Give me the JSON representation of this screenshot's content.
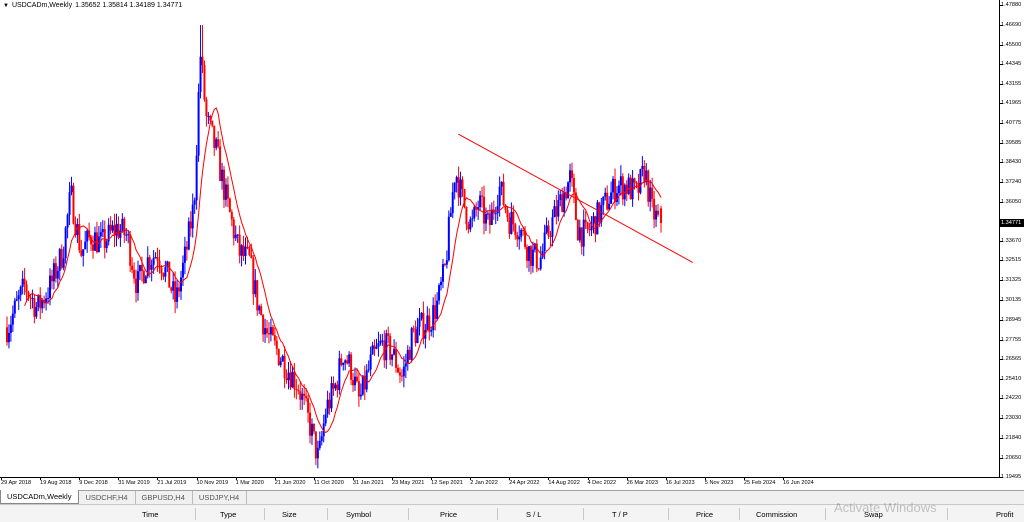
{
  "chart": {
    "title": "USDCADm,Weekly",
    "ohlc": "1.35652 1.35814 1.34189 1.34771",
    "current_price": "1.34771",
    "colors": {
      "bull": "#0000ff",
      "bear": "#ff0000",
      "ma": "#ff0000",
      "trendline": "#ff0000"
    }
  },
  "price_scale": [
    "1.47880",
    "1.46690",
    "1.45500",
    "1.44345",
    "1.43155",
    "1.41965",
    "1.40775",
    "1.39585",
    "1.38430",
    "1.37240",
    "1.36050",
    "1.33670",
    "1.32515",
    "1.31325",
    "1.30135",
    "1.28945",
    "1.27755",
    "1.26565",
    "1.25410",
    "1.24220",
    "1.23030",
    "1.21840",
    "1.20650",
    "1.19495"
  ],
  "time_scale": [
    "29 Apr 2018",
    "19 Aug 2018",
    "9 Dec 2018",
    "31 Mar 2019",
    "21 Jul 2019",
    "10 Nov 2019",
    "1 Mar 2020",
    "21 Jun 2020",
    "11 Oct 2020",
    "31 Jan 2021",
    "23 May 2021",
    "12 Sep 2021",
    "2 Jan 2022",
    "24 Apr 2022",
    "14 Aug 2022",
    "4 Dec 2022",
    "26 Mar 2023",
    "16 Jul 2023",
    "5 Nov 2023",
    "25 Feb 2024",
    "16 Jun 2024"
  ],
  "tabs": [
    "USDCADm,Weekly",
    "USDCHF,H4",
    "GBPUSD,H4",
    "USDJPY,H4"
  ],
  "terminal_columns": [
    "Time",
    "Type",
    "Size",
    "Symbol",
    "Price",
    "S / L",
    "T / P",
    "Price",
    "Commission",
    "Swap",
    "Profit"
  ],
  "watermark": "Activate Windows",
  "chart_data": {
    "type": "candlestick",
    "title": "USDCADm,Weekly",
    "x_labels": [
      "29 Apr 2018",
      "19 Aug 2018",
      "9 Dec 2018",
      "31 Mar 2019",
      "21 Jul 2019",
      "10 Nov 2019",
      "1 Mar 2020",
      "21 Jun 2020",
      "11 Oct 2020",
      "31 Jan 2021",
      "23 May 2021",
      "12 Sep 2021",
      "2 Jan 2022",
      "24 Apr 2022",
      "14 Aug 2022",
      "4 Dec 2022",
      "26 Mar 2023",
      "16 Jul 2023",
      "5 Nov 2023",
      "25 Feb 2024",
      "16 Jun 2024"
    ],
    "ylim": [
      1.19495,
      1.4788
    ],
    "last": {
      "open": 1.35652,
      "high": 1.35814,
      "low": 1.34189,
      "close": 1.34771
    },
    "trendline": {
      "from": [
        2022.75,
        1.4012
      ],
      "to": [
        2025.05,
        1.324
      ]
    },
    "close_path": [
      [
        2018.33,
        1.285
      ],
      [
        2018.5,
        1.31
      ],
      [
        2018.62,
        1.296
      ],
      [
        2018.75,
        1.31
      ],
      [
        2018.87,
        1.33
      ],
      [
        2018.95,
        1.365
      ],
      [
        2019.05,
        1.33
      ],
      [
        2019.15,
        1.34
      ],
      [
        2019.25,
        1.335
      ],
      [
        2019.4,
        1.345
      ],
      [
        2019.5,
        1.34
      ],
      [
        2019.6,
        1.31
      ],
      [
        2019.7,
        1.325
      ],
      [
        2019.8,
        1.33
      ],
      [
        2019.9,
        1.315
      ],
      [
        2019.98,
        1.3
      ],
      [
        2020.08,
        1.33
      ],
      [
        2020.16,
        1.36
      ],
      [
        2020.22,
        1.45
      ],
      [
        2020.28,
        1.41
      ],
      [
        2020.38,
        1.39
      ],
      [
        2020.48,
        1.36
      ],
      [
        2020.6,
        1.33
      ],
      [
        2020.7,
        1.325
      ],
      [
        2020.78,
        1.3
      ],
      [
        2020.88,
        1.28
      ],
      [
        2020.98,
        1.27
      ],
      [
        2021.08,
        1.26
      ],
      [
        2021.18,
        1.25
      ],
      [
        2021.3,
        1.225
      ],
      [
        2021.38,
        1.205
      ],
      [
        2021.45,
        1.235
      ],
      [
        2021.55,
        1.25
      ],
      [
        2021.62,
        1.27
      ],
      [
        2021.7,
        1.26
      ],
      [
        2021.78,
        1.24
      ],
      [
        2021.9,
        1.265
      ],
      [
        2022.0,
        1.275
      ],
      [
        2022.1,
        1.27
      ],
      [
        2022.2,
        1.255
      ],
      [
        2022.3,
        1.28
      ],
      [
        2022.38,
        1.285
      ],
      [
        2022.48,
        1.29
      ],
      [
        2022.55,
        1.3
      ],
      [
        2022.62,
        1.32
      ],
      [
        2022.72,
        1.38
      ],
      [
        2022.8,
        1.36
      ],
      [
        2022.88,
        1.345
      ],
      [
        2022.95,
        1.36
      ],
      [
        2023.05,
        1.345
      ],
      [
        2023.15,
        1.37
      ],
      [
        2023.25,
        1.35
      ],
      [
        2023.35,
        1.345
      ],
      [
        2023.45,
        1.33
      ],
      [
        2023.55,
        1.325
      ],
      [
        2023.65,
        1.345
      ],
      [
        2023.75,
        1.36
      ],
      [
        2023.85,
        1.375
      ],
      [
        2023.92,
        1.345
      ],
      [
        2024.0,
        1.34
      ],
      [
        2024.1,
        1.35
      ],
      [
        2024.2,
        1.36
      ],
      [
        2024.3,
        1.37
      ],
      [
        2024.4,
        1.37
      ],
      [
        2024.5,
        1.365
      ],
      [
        2024.58,
        1.38
      ],
      [
        2024.65,
        1.355
      ],
      [
        2024.72,
        1.348
      ]
    ]
  }
}
